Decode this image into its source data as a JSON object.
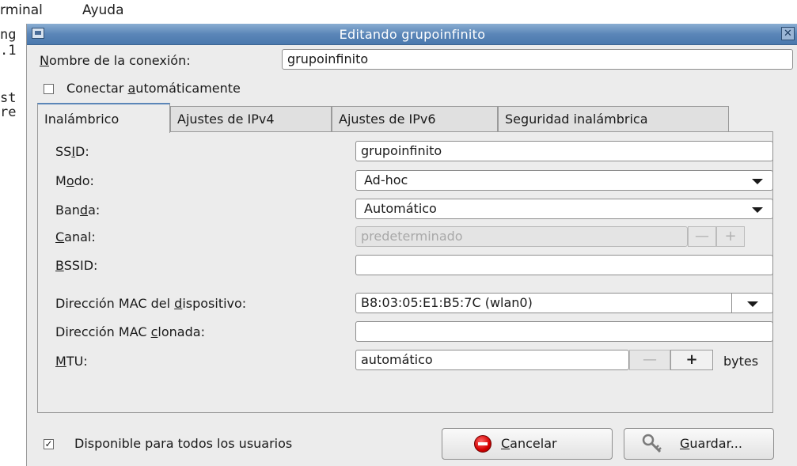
{
  "background": {
    "menu_items": [
      "rminal",
      "Ayuda"
    ],
    "terminal_lines": [
      "ng",
      ".1",
      "st",
      "re"
    ]
  },
  "window": {
    "title": "Editando grupoinfinito",
    "close_glyph": "✕"
  },
  "connection": {
    "name_label": "Nombre de la conexión:",
    "name_value": "grupoinfinito",
    "autoconnect_label": "Conectar automáticamente",
    "autoconnect_checked": false
  },
  "tabs": [
    {
      "label": "Inalámbrico",
      "active": true
    },
    {
      "label": "Ajustes de IPv4",
      "active": false
    },
    {
      "label": "Ajustes de IPv6",
      "active": false
    },
    {
      "label": "Seguridad inalámbrica",
      "active": false
    }
  ],
  "wireless": {
    "ssid_label": "SSID:",
    "ssid_value": "grupoinfinito",
    "mode_label": "Modo:",
    "mode_value": "Ad-hoc",
    "band_label": "Banda:",
    "band_value": "Automático",
    "channel_label": "Canal:",
    "channel_value": "predeterminado",
    "bssid_label": "BSSID:",
    "bssid_value": "",
    "device_mac_label": "Dirección MAC del dispositivo:",
    "device_mac_value": "B8:03:05:E1:B5:7C (wlan0)",
    "cloned_mac_label": "Dirección MAC clonada:",
    "cloned_mac_value": "",
    "mtu_label": "MTU:",
    "mtu_value": "automático",
    "mtu_unit": "bytes",
    "minus_glyph": "—",
    "plus_glyph": "+"
  },
  "footer": {
    "all_users_label": "Disponible para todos los usuarios",
    "all_users_checked": true,
    "check_glyph": "✓",
    "cancel_label": "Cancelar",
    "save_label": "Guardar..."
  },
  "colors": {
    "titlebar": "#5b86b8",
    "cancel_icon": "#d40000"
  }
}
